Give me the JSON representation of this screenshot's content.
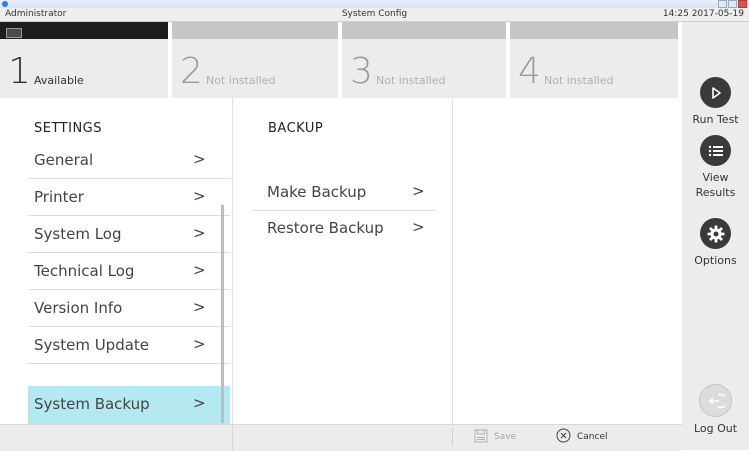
{
  "window": {
    "user": "Administrator",
    "title": "System Config",
    "datetime": "14:25 2017-05-19"
  },
  "modules": [
    {
      "number": "1",
      "status": "Available",
      "active": true
    },
    {
      "number": "2",
      "status": "Not installed",
      "active": false
    },
    {
      "number": "3",
      "status": "Not installed",
      "active": false
    },
    {
      "number": "4",
      "status": "Not installed",
      "active": false
    }
  ],
  "sidebar": {
    "run_test": {
      "label": "Run Test",
      "icon": "play-icon"
    },
    "view_results": {
      "label": "View Results",
      "icon": "list-icon"
    },
    "options": {
      "label": "Options",
      "icon": "gear-icon"
    },
    "log_out": {
      "label": "Log Out",
      "icon": "logout-icon"
    }
  },
  "settings": {
    "heading": "SETTINGS",
    "items": [
      {
        "label": "General",
        "chevron": ">"
      },
      {
        "label": "Printer",
        "chevron": ">"
      },
      {
        "label": "System Log",
        "chevron": ">"
      },
      {
        "label": "Technical Log",
        "chevron": ">"
      },
      {
        "label": "Version Info",
        "chevron": ">"
      },
      {
        "label": "System Update",
        "chevron": ">"
      },
      {
        "label": "System Backup",
        "chevron": ">",
        "selected": true
      }
    ]
  },
  "backup": {
    "heading": "BACKUP",
    "items": [
      {
        "label": "Make Backup",
        "chevron": ">"
      },
      {
        "label": "Restore Backup",
        "chevron": ">"
      }
    ]
  },
  "bottombar": {
    "save_label": "Save",
    "cancel_label": "Cancel"
  },
  "colors": {
    "selected_item": "#b5e9f1",
    "sidebar_button": "#3a3a3a",
    "active_module_strip": "#1d1d1d"
  }
}
